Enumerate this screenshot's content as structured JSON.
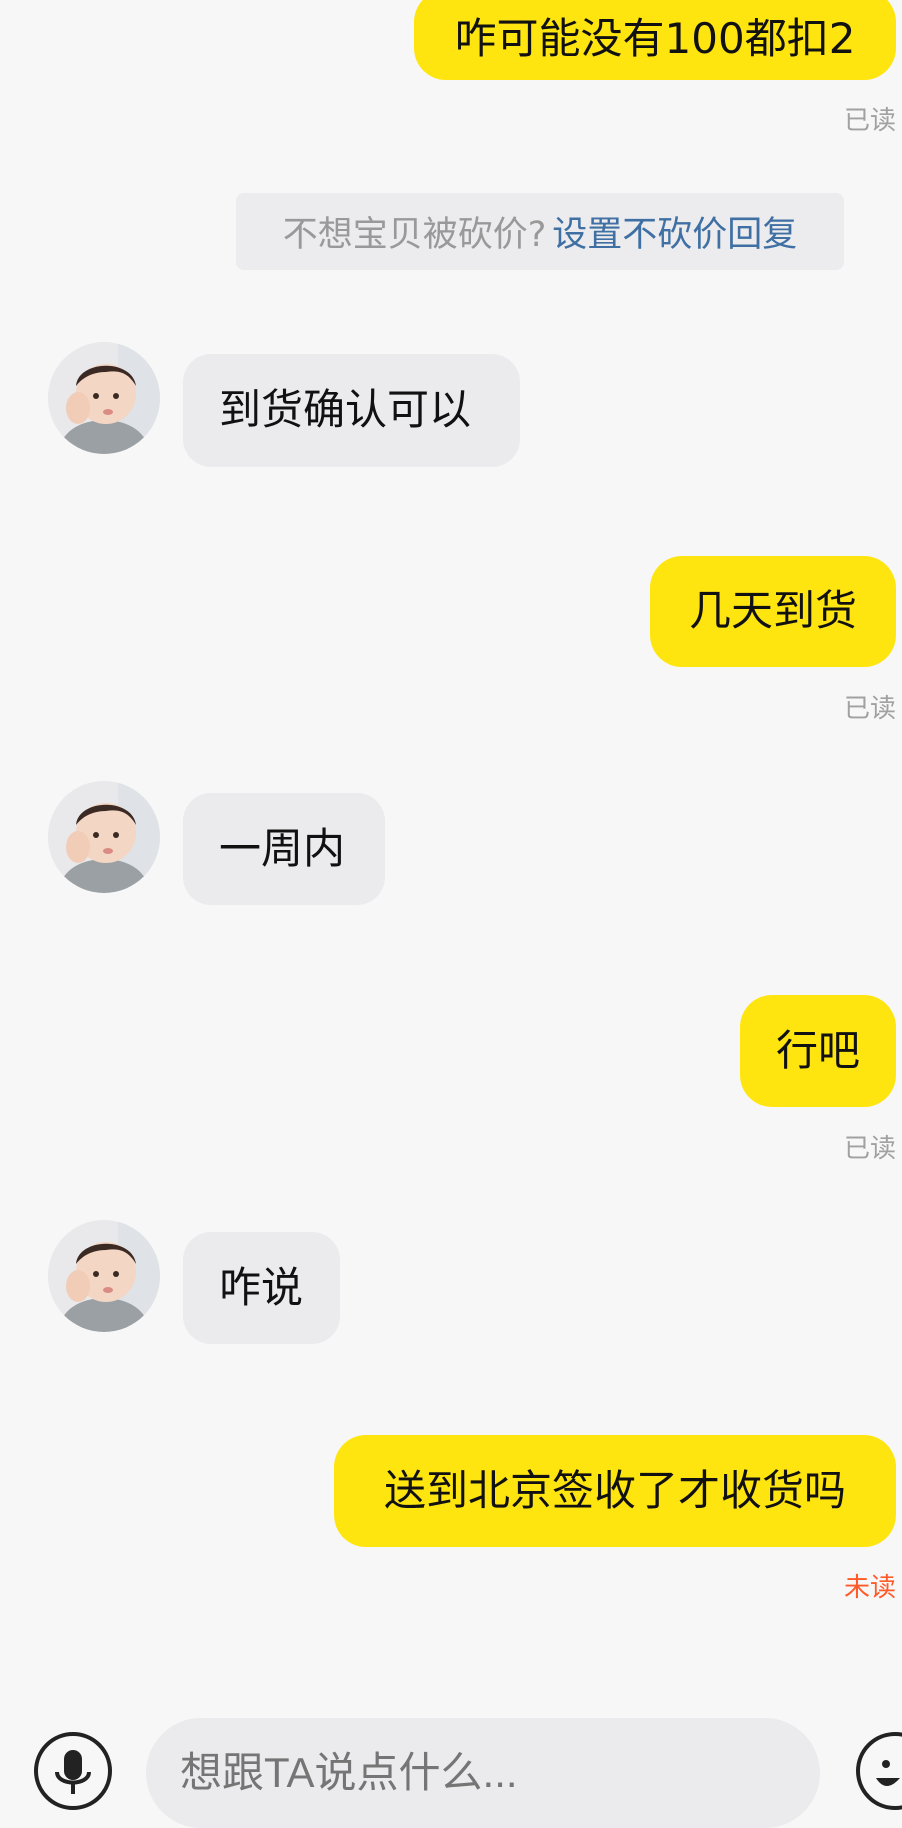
{
  "chat": {
    "messages": [
      {
        "direction": "outgoing",
        "text": "咋可能没有100都扣2",
        "status": "已读"
      },
      {
        "direction": "system",
        "text": "不想宝贝被砍价?",
        "link_text": "设置不砍价回复"
      },
      {
        "direction": "incoming",
        "text": "到货确认可以"
      },
      {
        "direction": "outgoing",
        "text": "几天到货",
        "status": "已读"
      },
      {
        "direction": "incoming",
        "text": "一周内"
      },
      {
        "direction": "outgoing",
        "text": "行吧",
        "status": "已读"
      },
      {
        "direction": "incoming",
        "text": "咋说"
      },
      {
        "direction": "outgoing",
        "text": "送到北京签收了才收货吗",
        "status": "未读"
      }
    ]
  },
  "input": {
    "placeholder": "想跟TA说点什么..."
  },
  "icons": {
    "voice": "microphone-icon",
    "emoji": "emoji-icon"
  },
  "colors": {
    "outgoing_bubble": "#ffe50f",
    "incoming_bubble": "#ebebed",
    "link": "#3f6fa3",
    "unread": "#ff5b2a",
    "read": "#a1a1a1"
  }
}
